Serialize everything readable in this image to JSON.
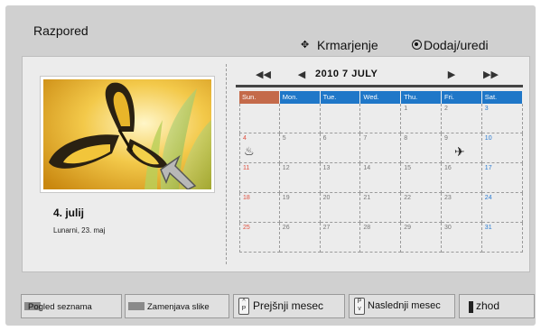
{
  "header": {
    "title": "Razpored",
    "hint_navigate_label": "Krmarjenje",
    "hint_add_label": "Dodaj/uredi"
  },
  "left_panel": {
    "selected_date": "4. julij",
    "lunar_date": "Lunarni, 23. maj"
  },
  "calendar": {
    "year": "2010",
    "month": "7 JULY",
    "month_heading": "2010  7  JULY",
    "weekdays": [
      "Sun.",
      "Mon.",
      "Tue.",
      "Wed.",
      "Thu.",
      "Fri.",
      "Sat."
    ],
    "weeks": [
      [
        "",
        "",
        "",
        "",
        "1",
        "2",
        "3"
      ],
      [
        "4",
        "5",
        "6",
        "7",
        "8",
        "9",
        "10"
      ],
      [
        "11",
        "12",
        "13",
        "14",
        "15",
        "16",
        "17"
      ],
      [
        "18",
        "19",
        "20",
        "21",
        "22",
        "23",
        "24"
      ],
      [
        "25",
        "26",
        "27",
        "28",
        "29",
        "30",
        "31"
      ]
    ],
    "events": [
      {
        "day": "4",
        "icon": "birthday-cake-icon"
      },
      {
        "day": "9",
        "icon": "airplane-icon"
      }
    ]
  },
  "bottom_bar": {
    "list_view_label": "Pogled seznama",
    "change_image_label": "Zamenjava slike",
    "prev_month_label": "Prejšnji mesec",
    "next_month_label": "Naslednji mesec",
    "exit_label": "zhod"
  },
  "colors": {
    "weekday_header": "#1f77c8",
    "sunday_header": "#c46a4a",
    "sunday_number": "#e05040",
    "saturday_number": "#2a7ad0"
  }
}
